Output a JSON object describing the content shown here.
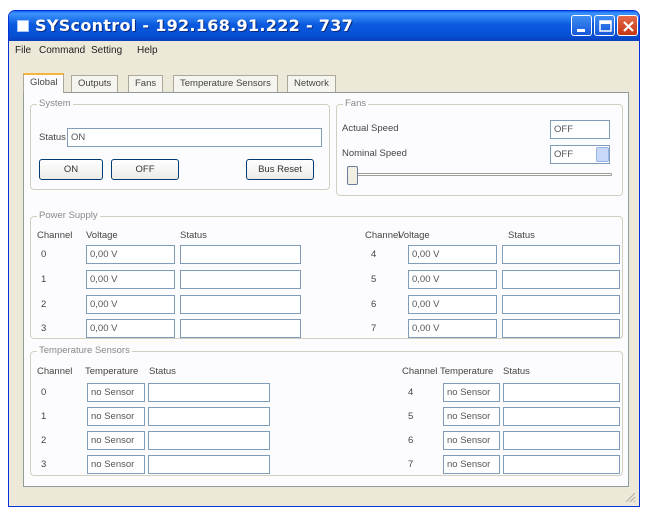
{
  "window": {
    "title": "SYScontrol - 192.168.91.222 - 737"
  },
  "menu": [
    "File",
    "Command",
    "Setting",
    "Help"
  ],
  "tabs": [
    "Global",
    "Outputs",
    "Fans",
    "Temperature Sensors",
    "Network"
  ],
  "system": {
    "label": "System",
    "status_label": "Status",
    "status_value": "ON",
    "on_button": "ON",
    "off_button": "OFF",
    "bus_reset_button": "Bus Reset"
  },
  "fans": {
    "label": "Fans",
    "actual_speed_label": "Actual Speed",
    "actual_speed_value": "OFF",
    "nominal_speed_label": "Nominal Speed",
    "nominal_speed_value": "OFF",
    "slider_level": 0
  },
  "power_supply": {
    "label": "Power Supply",
    "headers": {
      "channel": "Channel",
      "voltage": "Voltage",
      "status": "Status"
    },
    "left": [
      {
        "channel": "0",
        "voltage": "0,00 V",
        "status": ""
      },
      {
        "channel": "1",
        "voltage": "0,00 V",
        "status": ""
      },
      {
        "channel": "2",
        "voltage": "0,00 V",
        "status": ""
      },
      {
        "channel": "3",
        "voltage": "0,00 V",
        "status": ""
      }
    ],
    "right": [
      {
        "channel": "4",
        "voltage": "0,00 V",
        "status": ""
      },
      {
        "channel": "5",
        "voltage": "0,00 V",
        "status": ""
      },
      {
        "channel": "6",
        "voltage": "0,00 V",
        "status": ""
      },
      {
        "channel": "7",
        "voltage": "0,00 V",
        "status": ""
      }
    ]
  },
  "temperature_sensors": {
    "label": "Temperature Sensors",
    "headers": {
      "channel": "Channel",
      "temperature": "Temperature",
      "status": "Status"
    },
    "left": [
      {
        "channel": "0",
        "temperature": "no Sensor",
        "status": ""
      },
      {
        "channel": "1",
        "temperature": "no Sensor",
        "status": ""
      },
      {
        "channel": "2",
        "temperature": "no Sensor",
        "status": ""
      },
      {
        "channel": "3",
        "temperature": "no Sensor",
        "status": ""
      }
    ],
    "right": [
      {
        "channel": "4",
        "temperature": "no Sensor",
        "status": ""
      },
      {
        "channel": "5",
        "temperature": "no Sensor",
        "status": ""
      },
      {
        "channel": "6",
        "temperature": "no Sensor",
        "status": ""
      },
      {
        "channel": "7",
        "temperature": "no Sensor",
        "status": ""
      }
    ]
  },
  "icons": {
    "app": "window-icon",
    "minimize": "minimize-icon",
    "maximize": "maximize-icon",
    "close": "close-icon"
  },
  "colors": {
    "titlebar": "#0b5ade",
    "close_button": "#c63614",
    "active_tab_accent": "#f5b43d",
    "window_bg": "#ece9d8"
  }
}
